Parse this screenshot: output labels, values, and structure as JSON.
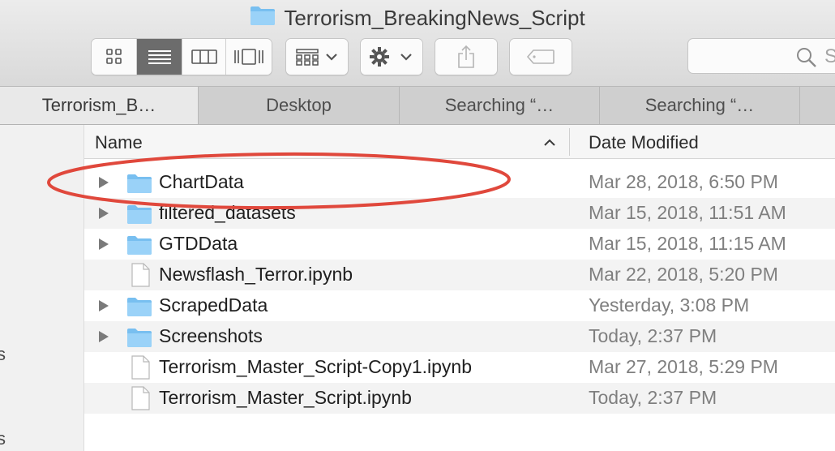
{
  "window": {
    "title": "Terrorism_BreakingNews_Script"
  },
  "toolbar": {
    "search_placeholder": "S"
  },
  "tabs": [
    {
      "label": "Terrorism_B…",
      "active": true
    },
    {
      "label": "Desktop",
      "active": false
    },
    {
      "label": "Searching “…",
      "active": false
    },
    {
      "label": "Searching “…",
      "active": false
    }
  ],
  "sidebar": {
    "fragments": [
      "s",
      "s"
    ]
  },
  "list": {
    "columns": {
      "name": "Name",
      "date": "Date Modified"
    },
    "rows": [
      {
        "name": "ChartData",
        "date": "Mar 28, 2018, 6:50 PM",
        "kind": "folder"
      },
      {
        "name": "filtered_datasets",
        "date": "Mar 15, 2018, 11:51 AM",
        "kind": "folder"
      },
      {
        "name": "GTDData",
        "date": "Mar 15, 2018, 11:15 AM",
        "kind": "folder"
      },
      {
        "name": "Newsflash_Terror.ipynb",
        "date": "Mar 22, 2018, 5:20 PM",
        "kind": "file"
      },
      {
        "name": "ScrapedData",
        "date": "Yesterday, 3:08 PM",
        "kind": "folder"
      },
      {
        "name": "Screenshots",
        "date": "Today, 2:37 PM",
        "kind": "folder"
      },
      {
        "name": "Terrorism_Master_Script-Copy1.ipynb",
        "date": "Mar 27, 2018, 5:29 PM",
        "kind": "file"
      },
      {
        "name": "Terrorism_Master_Script.ipynb",
        "date": "Today, 2:37 PM",
        "kind": "file"
      }
    ]
  },
  "colors": {
    "folder": "#7cc2f3",
    "annotation": "#e0483c",
    "active_view": "#6c6c6c"
  }
}
